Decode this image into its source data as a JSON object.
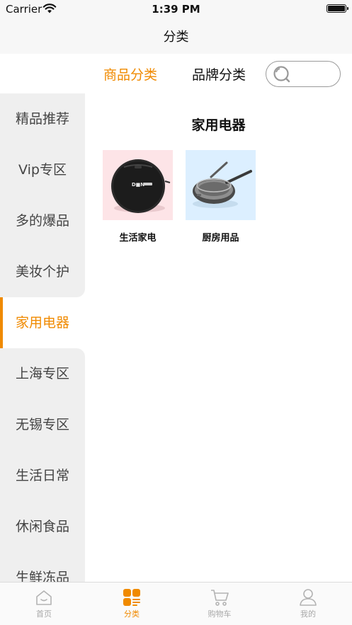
{
  "status_bar": {
    "carrier": "Carrier",
    "time": "1:39 PM"
  },
  "nav": {
    "title": "分类"
  },
  "top_tabs": {
    "goods": "商品分类",
    "brand": "品牌分类"
  },
  "sidebar": {
    "items": [
      {
        "label": "精品推荐"
      },
      {
        "label": "Vip专区"
      },
      {
        "label": "多的爆品"
      },
      {
        "label": "美妆个护"
      },
      {
        "label": "家用电器"
      },
      {
        "label": "上海专区"
      },
      {
        "label": "无锡专区"
      },
      {
        "label": "生活日常"
      },
      {
        "label": "休闲食品"
      },
      {
        "label": "生鲜冻品"
      }
    ],
    "active_index": 4
  },
  "content": {
    "title": "家用电器",
    "items": [
      {
        "label": "生活家电",
        "icon": "robot-vacuum-image"
      },
      {
        "label": "厨房用品",
        "icon": "frying-pan-image"
      }
    ]
  },
  "tab_bar": {
    "items": [
      {
        "label": "首页",
        "icon": "home-icon"
      },
      {
        "label": "分类",
        "icon": "category-icon"
      },
      {
        "label": "购物车",
        "icon": "cart-icon"
      },
      {
        "label": "我的",
        "icon": "profile-icon"
      }
    ],
    "active_index": 1
  },
  "colors": {
    "accent": "#f08a00",
    "sidebar_bg": "#efefef",
    "inactive_tab": "#a8a8a8"
  }
}
